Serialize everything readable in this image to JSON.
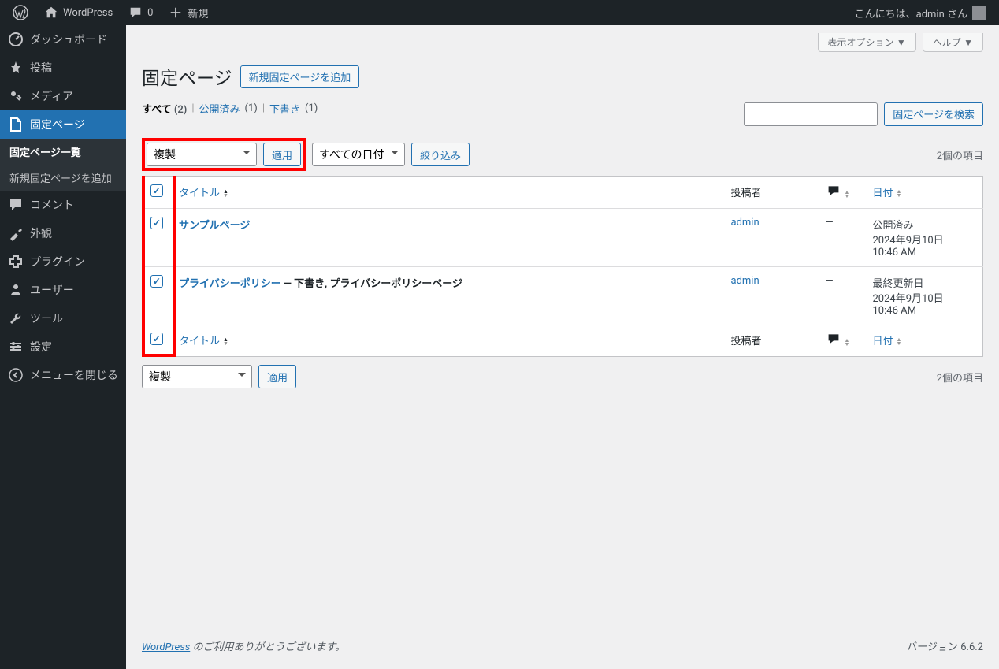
{
  "adminbar": {
    "site_name": "WordPress",
    "comments": "0",
    "new": "新規",
    "greeting": "こんにちは、admin さん"
  },
  "sidebar": {
    "items": [
      {
        "label": "ダッシュボード",
        "icon": "dashboard"
      },
      {
        "label": "投稿",
        "icon": "pin"
      },
      {
        "label": "メディア",
        "icon": "media"
      },
      {
        "label": "固定ページ",
        "icon": "page",
        "current": true
      },
      {
        "label": "コメント",
        "icon": "comment"
      },
      {
        "label": "外観",
        "icon": "appearance"
      },
      {
        "label": "プラグイン",
        "icon": "plugin"
      },
      {
        "label": "ユーザー",
        "icon": "users"
      },
      {
        "label": "ツール",
        "icon": "tools"
      },
      {
        "label": "設定",
        "icon": "settings"
      },
      {
        "label": "メニューを閉じる",
        "icon": "collapse"
      }
    ],
    "submenu": [
      {
        "label": "固定ページ一覧",
        "current": true
      },
      {
        "label": "新規固定ページを追加"
      }
    ]
  },
  "screen_meta": {
    "display_options": "表示オプション",
    "help": "ヘルプ"
  },
  "header": {
    "title": "固定ページ",
    "add_new": "新規固定ページを追加"
  },
  "filters": {
    "all": "すべて",
    "all_count": "(2)",
    "published": "公開済み",
    "published_count": "(1)",
    "draft": "下書き",
    "draft_count": "(1)"
  },
  "search": {
    "button": "固定ページを検索"
  },
  "tablenav": {
    "bulk_action": "複製",
    "apply": "適用",
    "all_dates": "すべての日付",
    "filter": "絞り込み",
    "item_count": "2個の項目"
  },
  "table": {
    "columns": {
      "title": "タイトル",
      "author": "投稿者",
      "date": "日付"
    },
    "rows": [
      {
        "title": "サンプルページ",
        "state": "",
        "author": "admin",
        "comments": "—",
        "date_status": "公開済み",
        "date_line1": "2024年9月10日",
        "date_line2": "10:46 AM"
      },
      {
        "title": "プライバシーポリシー",
        "state": " — 下書き, プライバシーポリシーページ",
        "author": "admin",
        "comments": "—",
        "date_status": "最終更新日",
        "date_line1": "2024年9月10日",
        "date_line2": "10:46 AM"
      }
    ]
  },
  "footer": {
    "thanks_link": "WordPress",
    "thanks_text": " のご利用ありがとうございます。",
    "version": "バージョン 6.6.2"
  }
}
